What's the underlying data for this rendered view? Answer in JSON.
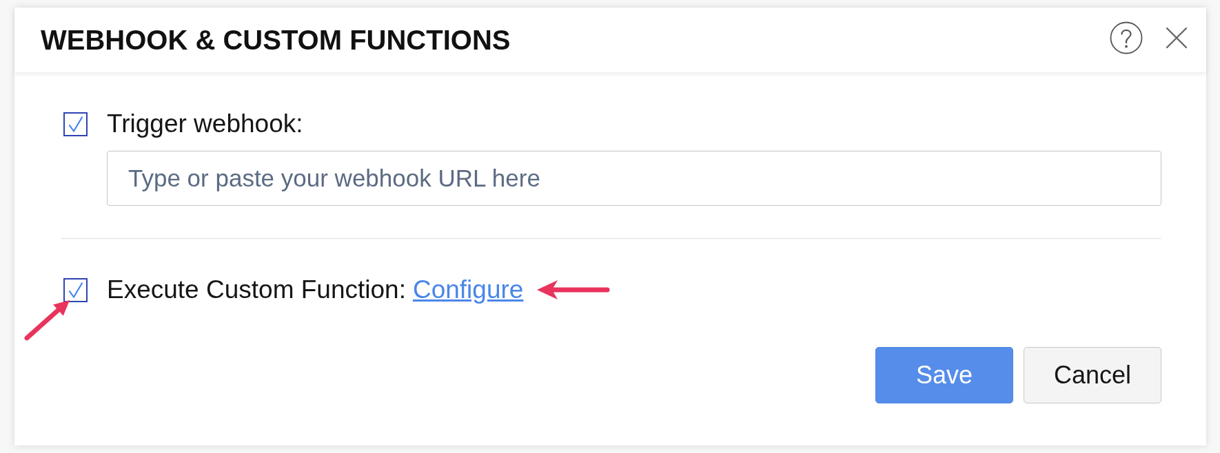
{
  "dialog": {
    "title": "WEBHOOK & CUSTOM FUNCTIONS"
  },
  "options": [
    {
      "kind": "webhook",
      "label": "Trigger webhook:",
      "checked": true,
      "field": {
        "placeholder": "Type or paste your webhook URL here"
      }
    },
    {
      "kind": "function",
      "label": "Execute Custom Function:",
      "checked": true,
      "checkbox_arrow": true,
      "link": {
        "text": "Configure",
        "arrow": true
      }
    }
  ],
  "buttons": [
    {
      "label": "Save",
      "kind": "primary"
    },
    {
      "label": "Cancel",
      "kind": "secondary"
    }
  ]
}
